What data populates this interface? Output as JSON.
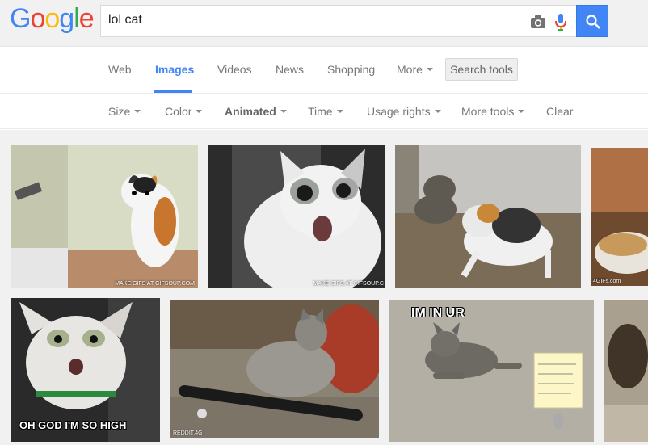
{
  "logo": {
    "letters": [
      "G",
      "o",
      "o",
      "g",
      "l",
      "e"
    ],
    "colors": [
      "#4285f4",
      "#ea4335",
      "#fbbc05",
      "#4285f4",
      "#34a853",
      "#ea4335"
    ]
  },
  "search": {
    "query": "lol cat"
  },
  "icons": {
    "camera": "camera-icon",
    "mic": "microphone-icon",
    "search": "magnifier-icon"
  },
  "tabs": [
    {
      "label": "Web"
    },
    {
      "label": "Images"
    },
    {
      "label": "Videos"
    },
    {
      "label": "News"
    },
    {
      "label": "Shopping"
    },
    {
      "label": "More"
    }
  ],
  "search_tools_label": "Search tools",
  "filters": [
    {
      "label": "Size"
    },
    {
      "label": "Color"
    },
    {
      "label": "Animated"
    },
    {
      "label": "Time"
    },
    {
      "label": "Usage rights"
    },
    {
      "label": "More tools"
    },
    {
      "label": "Clear"
    }
  ],
  "results": [
    {
      "watermark": "MAKE GIFS AT GIFSOUP.COM"
    },
    {
      "watermark": "MAKE GIFS AT GIFSOUP.C"
    },
    {
      "watermark": ""
    },
    {
      "watermark": "4GIFs.com"
    },
    {
      "caption": "OH GOD I'M SO HIGH"
    },
    {
      "watermark": "REDDIT.4G"
    },
    {
      "caption": "IM IN UR"
    },
    {
      "watermark": ""
    }
  ],
  "colors": {
    "accent": "#4285f4",
    "header_bg": "#f1f1f1"
  }
}
